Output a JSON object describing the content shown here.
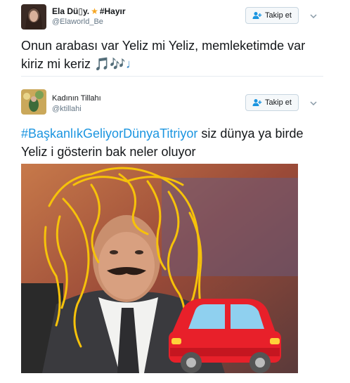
{
  "tweets": [
    {
      "name": "Ela Dü▯y.",
      "badge": "#Hayır",
      "handle": "@Elaworld_Be",
      "follow_label": "Takip et",
      "text": "Onun arabası var Yeliz mi Yeliz, memleketimde var kiriz mi keriz",
      "emoji": "🎵🎶♩"
    },
    {
      "name": "Kadının Tillahı",
      "handle": "@ktillahi",
      "follow_label": "Takip et",
      "hashtag": "#BaşkanlıkGeliyorDünyaTitriyor",
      "text": " siz dünya ya birde Yeliz i gösterin bak neler oluyor"
    }
  ],
  "icons": [
    "follow-user-icon",
    "chevron-down-icon",
    "car-emoji"
  ]
}
